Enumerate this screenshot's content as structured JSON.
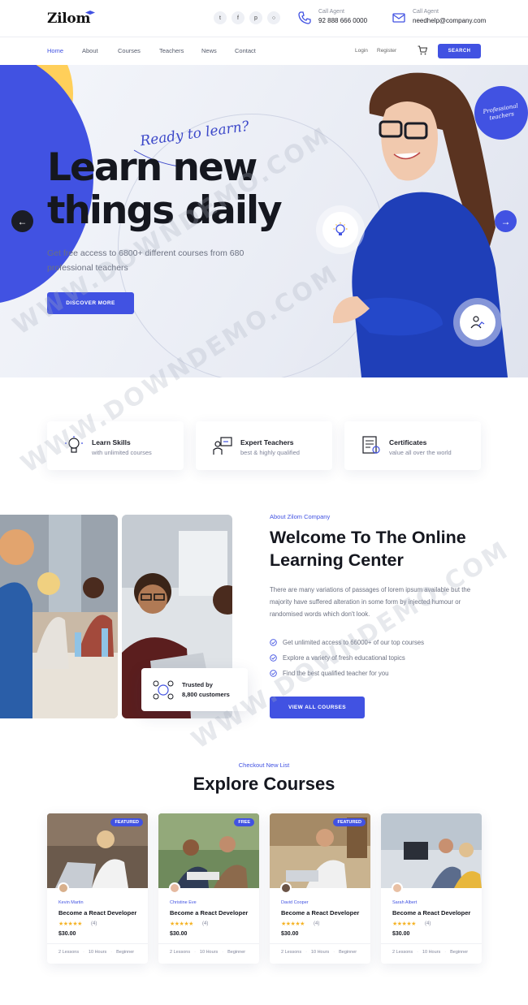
{
  "brand": {
    "logo": "Zilom"
  },
  "header": {
    "socials": [
      "twitter-icon",
      "facebook-icon",
      "pinterest-icon",
      "instagram-icon"
    ],
    "phone": {
      "label": "Call Agent",
      "value": "92 888 666 0000"
    },
    "email": {
      "label": "Call Agent",
      "value": "needhelp@company.com"
    }
  },
  "nav": {
    "items": [
      {
        "label": "Home",
        "active": true
      },
      {
        "label": "About"
      },
      {
        "label": "Courses"
      },
      {
        "label": "Teachers"
      },
      {
        "label": "News"
      },
      {
        "label": "Contact"
      }
    ],
    "login": "Login",
    "register": "Register",
    "search_label": "SEARCH"
  },
  "hero": {
    "script": "Ready to learn?",
    "title_line1": "Learn new",
    "title_line2": "things daily",
    "subtitle": "Get free access to 6800+ different courses from 680 professional teachers",
    "cta": "DISCOVER MORE",
    "badge": "Professional teachers"
  },
  "features": [
    {
      "title": "Learn Skills",
      "subtitle": "with unlimited courses",
      "icon": "bulb-head-icon"
    },
    {
      "title": "Expert Teachers",
      "subtitle": "best & highly qualified",
      "icon": "teacher-board-icon"
    },
    {
      "title": "Certificates",
      "subtitle": "value all over the world",
      "icon": "certificate-icon"
    }
  ],
  "about": {
    "eyebrow": "About Zilom Company",
    "title": "Welcome To The Online Learning Center",
    "paragraph": "There are many variations of passages of lorem ipsum available but the majority have suffered alteration in some form by injected humour or randomised words which don't look.",
    "checks": [
      "Get unlimited access to 66000+ of our top courses",
      "Explore a variety of fresh educational topics",
      "Find the best qualified teacher for you"
    ],
    "trusted_line1": "Trusted by",
    "trusted_line2": "8,800 customers",
    "cta": "VIEW ALL COURSES"
  },
  "courses": {
    "eyebrow": "Checkout New List",
    "title": "Explore Courses",
    "items": [
      {
        "tag": "FEATURED",
        "author": "Kevin Martin",
        "title": "Become a React Developer",
        "rating": "(4)",
        "price": "$30.00",
        "lessons": "2 Lessons",
        "hours": "10 Hours",
        "level": "Beginner"
      },
      {
        "tag": "FREE",
        "author": "Christine Eve",
        "title": "Become a React Developer",
        "rating": "(4)",
        "price": "$30.00",
        "lessons": "2 Lessons",
        "hours": "10 Hours",
        "level": "Beginner"
      },
      {
        "tag": "FEATURED",
        "author": "David Cooper",
        "title": "Become a React Developer",
        "rating": "(4)",
        "price": "$30.00",
        "lessons": "2 Lessons",
        "hours": "10 Hours",
        "level": "Beginner"
      },
      {
        "tag": "",
        "author": "Sarah Albert",
        "title": "Become a React Developer",
        "rating": "(4)",
        "price": "$30.00",
        "lessons": "2 Lessons",
        "hours": "10 Hours",
        "level": "Beginner"
      }
    ]
  },
  "watermark": "WWW.DOWNDEMO.COM",
  "colors": {
    "accent": "#4152e2",
    "yellow": "#ffcf5a",
    "dark": "#15171f",
    "star": "#f5b325"
  }
}
